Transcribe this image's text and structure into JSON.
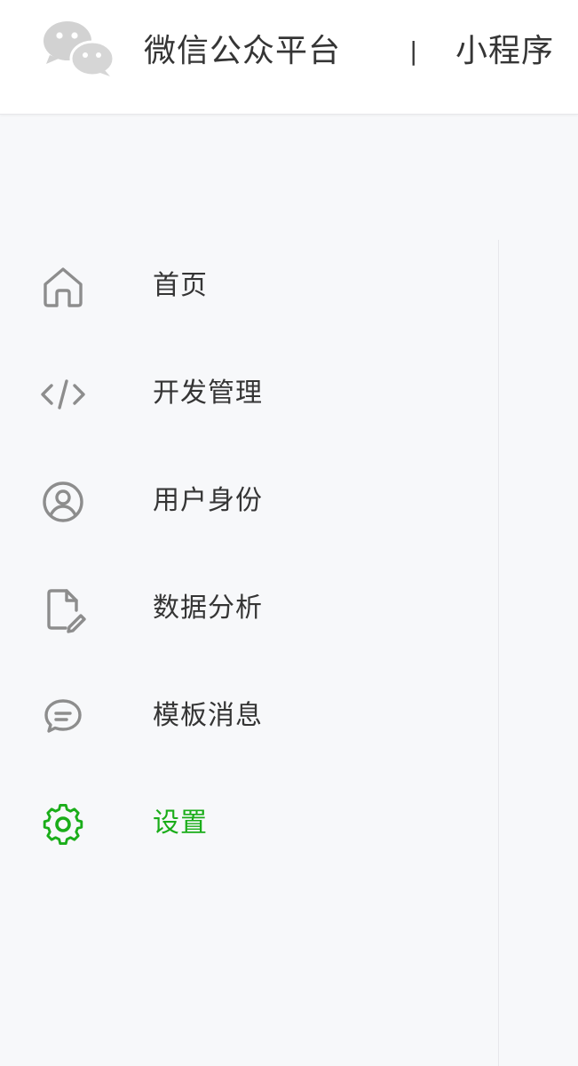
{
  "header": {
    "brand_name": "微信公众平台",
    "separator": "|",
    "product": "小程序",
    "logo_icon": "wechat-logo-icon"
  },
  "menu": {
    "items": [
      {
        "label": "首页",
        "icon": "home-icon",
        "active": false
      },
      {
        "label": "开发管理",
        "icon": "code-icon",
        "active": false
      },
      {
        "label": "用户身份",
        "icon": "user-circle-icon",
        "active": false
      },
      {
        "label": "数据分析",
        "icon": "document-edit-icon",
        "active": false
      },
      {
        "label": "模板消息",
        "icon": "message-bubble-icon",
        "active": false
      },
      {
        "label": "设置",
        "icon": "gear-icon",
        "active": true
      }
    ]
  },
  "colors": {
    "active": "#1aad19",
    "icon_gray": "#8d8d8d",
    "text": "#353535",
    "sidebar_bg": "#f7f8fa",
    "divider": "#e7e7eb"
  }
}
